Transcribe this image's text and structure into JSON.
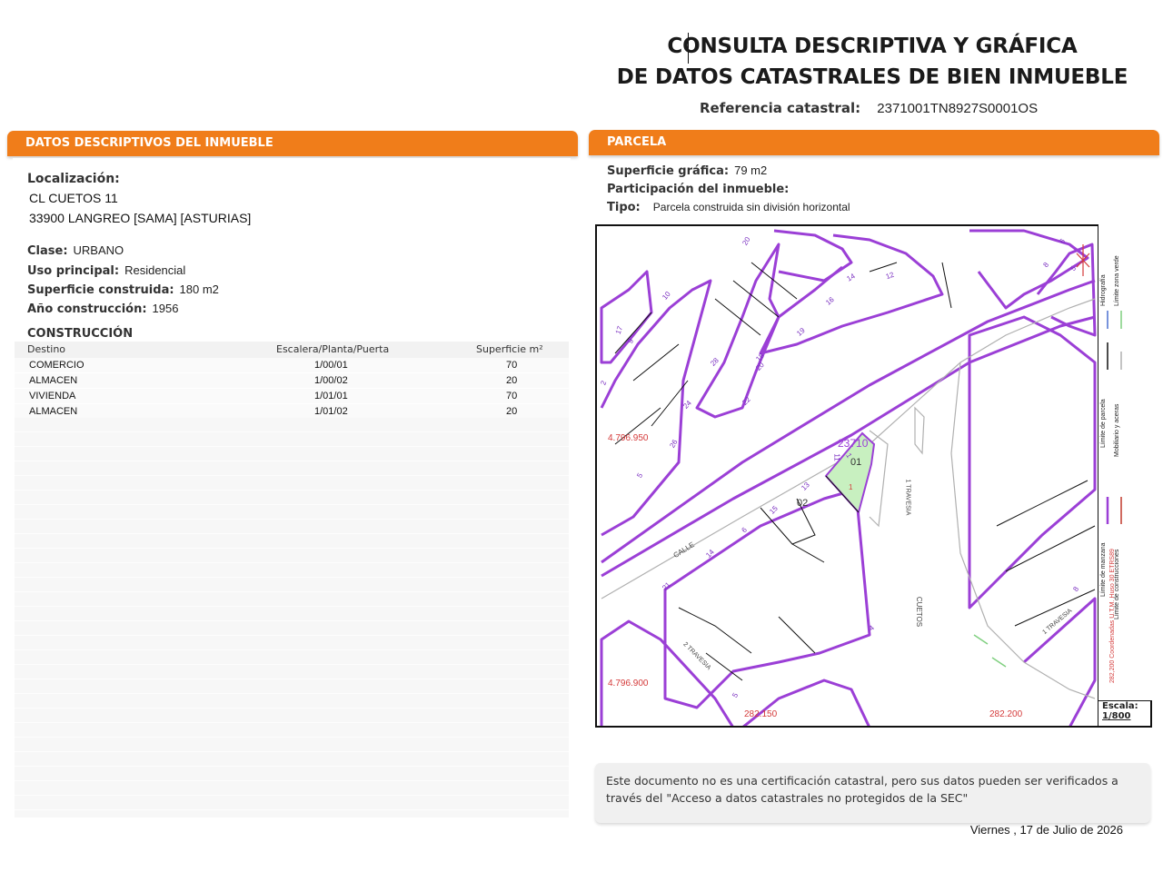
{
  "header": {
    "title_line1": "CONSULTA DESCRIPTIVA Y GRÁFICA",
    "title_line2": "DE DATOS CATASTRALES DE BIEN INMUEBLE",
    "ref_label": "Referencia catastral:",
    "ref_value": "2371001TN8927S0001OS"
  },
  "left": {
    "section_title": "DATOS DESCRIPTIVOS DEL INMUEBLE",
    "localizacion_label": "Localización:",
    "address_line1": "CL CUETOS 11",
    "address_line2": "33900 LANGREO [SAMA] [ASTURIAS]",
    "clase_label": "Clase:",
    "clase_value": "URBANO",
    "uso_label": "Uso principal:",
    "uso_value": "Residencial",
    "sup_label": "Superficie construida:",
    "sup_value": "180 m2",
    "anio_label": "Año construcción:",
    "anio_value": "1956",
    "construccion_title": "CONSTRUCCIÓN",
    "table_headers": [
      "Destino",
      "Escalera/Planta/Puerta",
      "Superficie m²"
    ],
    "rows": [
      [
        "COMERCIO",
        "1/00/01",
        "70"
      ],
      [
        "ALMACEN",
        "1/00/02",
        "20"
      ],
      [
        "VIVIENDA",
        "1/01/01",
        "70"
      ],
      [
        "ALMACEN",
        "1/01/02",
        "20"
      ]
    ]
  },
  "right": {
    "section_title": "PARCELA",
    "sup_grafica_label": "Superficie gráfica:",
    "sup_grafica_value": "79 m2",
    "participacion_label": "Participación del inmueble:",
    "tipo_label": "Tipo:",
    "tipo_value": "Parcela construida sin división horizontal"
  },
  "map": {
    "parcel_ref": "23710",
    "unit_01": "01",
    "unit_02": "02",
    "parcel_marker": "1",
    "street_calle": "CALLE",
    "street_cuetos": "CUETOS",
    "street_transversal1": "1 TRAVESIA",
    "street_transversal2": "1 TRAVESIA",
    "street_transversal3": "2 TRAVESIA",
    "coord_y1": "4.796.950",
    "coord_y2": "4.796.900",
    "coord_x1": "282.150",
    "coord_x2": "282.200",
    "house_numbers": [
      "20",
      "6",
      "8",
      "5",
      "14",
      "12",
      "16",
      "10",
      "19",
      "9",
      "17",
      "18",
      "28",
      "20",
      "24",
      "22",
      "26",
      "5",
      "2",
      "11",
      "13",
      "15",
      "6",
      "14",
      "21",
      "4",
      "5",
      "8",
      "1"
    ],
    "legend_items": [
      {
        "label": "Hidrografía",
        "color": "#4a6fd1"
      },
      {
        "label": "Límite zona verde",
        "color": "#7fcf7f"
      },
      {
        "label": "Límite de parcela",
        "color": "#111111"
      },
      {
        "label": "Mobiliario y aceras",
        "color": "#b0b0b0"
      },
      {
        "label": "Límite de manzana",
        "color": "#9b3fd6"
      },
      {
        "label": "Límite de construcciones",
        "color": "#c0392b"
      }
    ],
    "coords_note": "282,200 Coordenadas U.T.M. Huso 30 ETRS89",
    "scale_label": "Escala:",
    "scale_value": "1/800"
  },
  "footer": {
    "note_line1": "Este documento no es una certificación catastral, pero sus datos pueden ser verificados a",
    "note_line2": "través del \"Acceso a datos catastrales no protegidos de la SEC\"",
    "date": "Viernes , 17 de Julio de 2026"
  },
  "colors": {
    "accent": "#f07d1a",
    "block": "#9b3fd6",
    "parcel_fill": "#c8f0c0",
    "coords": "#d43a3a"
  }
}
